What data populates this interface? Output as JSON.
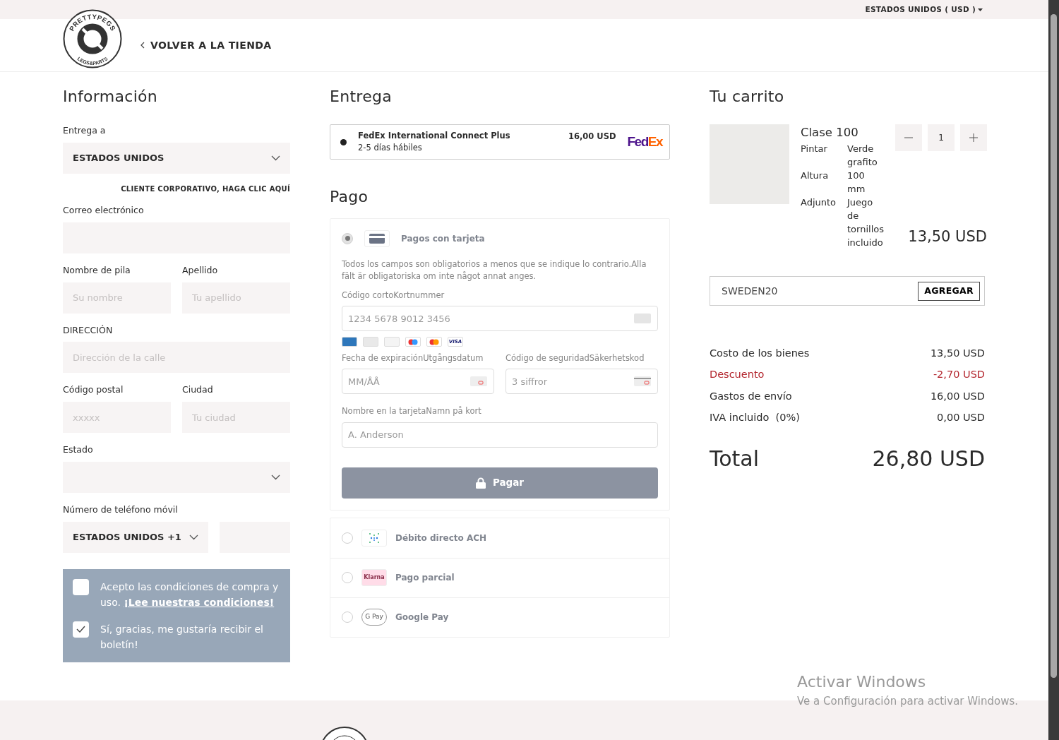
{
  "top_bar": {
    "region": "ESTADOS UNIDOS ( USD )"
  },
  "header": {
    "logo": {
      "top_text": "PRETTYPEGS",
      "bottom_text": "LEGS&PARTS"
    },
    "back_link": "VOLVER A LA TIENDA"
  },
  "information": {
    "title": "Información",
    "rows": [
      {
        "kind": "select",
        "label": "Entrega a",
        "value": "ESTADOS UNIDOS"
      },
      {
        "kind": "link",
        "text": "CLIENTE CORPORATIVO, HAGA CLIC AQUÍ"
      },
      {
        "kind": "fields",
        "fields": [
          {
            "label": "Correo electrónico"
          }
        ]
      },
      {
        "kind": "fields",
        "fields": [
          {
            "label": "Nombre de pila",
            "placeholder": "Su nombre"
          },
          {
            "label": "Apellido",
            "placeholder": "Tu apellido"
          }
        ]
      },
      {
        "kind": "fields",
        "fields": [
          {
            "label": "DIRECCIÓN",
            "placeholder": "Dirección de la calle"
          }
        ]
      },
      {
        "kind": "fields",
        "fields": [
          {
            "label": "Código postal",
            "placeholder": "xxxxx"
          },
          {
            "label": "Ciudad",
            "placeholder": "Tu ciudad"
          }
        ]
      },
      {
        "kind": "select",
        "label": "Estado"
      },
      {
        "kind": "phone",
        "label": "Número de teléfono móvil",
        "country": "ESTADOS UNIDOS +1"
      }
    ],
    "consents": [
      {
        "text": "Acepto las condiciones de compra y uso. ",
        "link": "¡Lee nuestras condiciones!",
        "checked": false
      },
      {
        "text": "Sí, gracias, me gustaría recibir el boletín!",
        "checked": true
      }
    ]
  },
  "delivery": {
    "title": "Entrega",
    "options": [
      {
        "name": "FedEx International Connect Plus",
        "time": "2-5 días hábiles",
        "price": "16,00 USD",
        "carrier": "FedEx",
        "selected": true
      }
    ]
  },
  "payment": {
    "title": "Pago",
    "disabled": true,
    "methods": [
      {
        "kind": "card",
        "name": "Pagos con tarjeta",
        "selected": true,
        "note": "Todos los campos son obligatorios a menos que se indique lo contrario.Alla fält är obligatoriska om inte något annat anges.",
        "number": {
          "label": "Código cortoKortnummer",
          "placeholder": "1234 5678 9012 3456"
        },
        "brands": [
          {
            "kind": "amex"
          },
          {
            "kind": "diners"
          },
          {
            "kind": "discover"
          },
          {
            "kind": "maestro"
          },
          {
            "kind": "mastercard"
          },
          {
            "kind": "visa",
            "label": "VISA"
          }
        ],
        "expiry": {
          "label": "Fecha de expiraciónUtgångsdatum",
          "placeholder": "MM/ÅÅ"
        },
        "cvc": {
          "label": "Código de seguridadSäkerhetskod",
          "placeholder": "3 siffror"
        },
        "holder": {
          "label": "Nombre en la tarjetaNamn på kort",
          "placeholder": "A. Anderson"
        },
        "pay_button": "Pagar"
      },
      {
        "kind": "ach",
        "name": "Débito directo ACH",
        "selected": false
      },
      {
        "kind": "klarna",
        "name": "Pago parcial",
        "badge": "Klarna",
        "selected": false
      },
      {
        "kind": "gpay",
        "name": "Google Pay",
        "badge": "G Pay",
        "selected": false
      }
    ]
  },
  "cart": {
    "title": "Tu carrito",
    "items": [
      {
        "name": "Clase 100",
        "attributes": [
          {
            "label": "Pintar",
            "value": "Verde grafito"
          },
          {
            "label": "Altura",
            "value": "100 mm"
          },
          {
            "label": "Adjunto",
            "value": "Juego de tornillos incluido"
          }
        ],
        "quantity": "1",
        "price": "13,50 USD"
      }
    ],
    "coupon": {
      "value": "SWEDEN20",
      "button": "AGREGAR"
    },
    "summary": [
      {
        "label": "Costo de los bienes",
        "value": "13,50 USD",
        "kind": "normal"
      },
      {
        "label": "Descuento",
        "value": "-2,70 USD",
        "kind": "discount"
      },
      {
        "label": "Gastos de envío",
        "value": "16,00 USD",
        "kind": "normal"
      },
      {
        "label": "IVA incluido  (0%)",
        "value": "0,00 USD",
        "kind": "normal"
      }
    ],
    "total": {
      "label": "Total",
      "value": "26,80 USD"
    }
  },
  "os_overlay": {
    "title": "Activar Windows",
    "subtitle": "Ve a Configuración para activar Windows."
  }
}
